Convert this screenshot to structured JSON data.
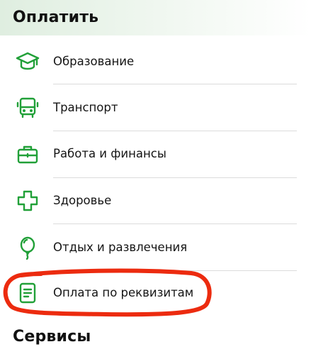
{
  "pay_section": {
    "title": "Оплатить",
    "items": [
      {
        "label": "Образование",
        "icon": "graduation-cap-icon"
      },
      {
        "label": "Транспорт",
        "icon": "bus-icon"
      },
      {
        "label": "Работа и финансы",
        "icon": "briefcase-icon"
      },
      {
        "label": "Здоровье",
        "icon": "medical-cross-icon"
      },
      {
        "label": "Отдых и развлечения",
        "icon": "balloon-icon"
      },
      {
        "label": "Оплата по реквизитам",
        "icon": "document-icon"
      }
    ]
  },
  "services_section": {
    "title": "Сервисы"
  },
  "colors": {
    "accent_green": "#21a038",
    "header_tint": "#dfeee0",
    "annotation_red": "#ec2b0f",
    "divider": "#dcdcdc"
  }
}
